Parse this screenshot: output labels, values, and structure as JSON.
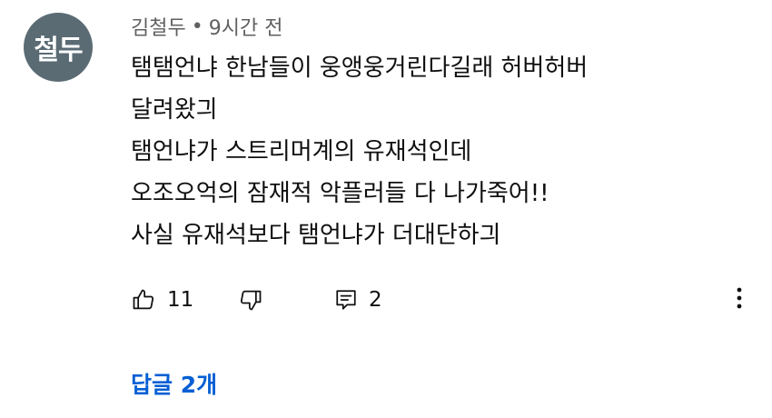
{
  "comment": {
    "avatar_text": "철두",
    "author": "김철두",
    "separator": "•",
    "timestamp": "9시간 전",
    "lines": [
      "탬탬언냐 한남들이 웅앵웅거린다길래 허버허버",
      "달려왔긔",
      "탬언냐가 스트리머계의 유재석인데",
      "오조오억의 잠재적 악플러들 다 나가죽어!!",
      "사실 유재석보다 탬언냐가 더대단하긔"
    ],
    "like_count": "11",
    "reply_count": "2",
    "replies_link": "답글 2개"
  },
  "icons": {
    "like": "thumbs-up-icon",
    "dislike": "thumbs-down-icon",
    "reply": "reply-comment-icon",
    "more": "more-vertical-icon"
  },
  "colors": {
    "avatar_bg": "#5a6b74",
    "meta_text": "#606060",
    "link_blue": "#065fd4"
  }
}
